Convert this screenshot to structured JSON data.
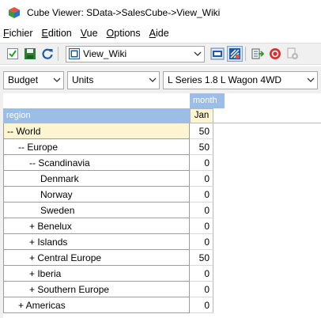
{
  "window": {
    "title": "Cube Viewer: SData->SalesCube->View_Wiki"
  },
  "menu": [
    {
      "label": "Fichier",
      "accel": "F"
    },
    {
      "label": "Edition",
      "accel": "E"
    },
    {
      "label": "Vue",
      "accel": "V"
    },
    {
      "label": "Options",
      "accel": "O"
    },
    {
      "label": "Aide",
      "accel": "A"
    }
  ],
  "toolbar": {
    "view_name": "View_Wiki",
    "icons": [
      "checkbox-icon",
      "save-icon",
      "refresh-icon",
      "view-icon",
      "excel-icon",
      "grid-icon",
      "export-icon",
      "stop-icon",
      "settings-icon"
    ]
  },
  "filters": {
    "version": "Budget",
    "measure": "Units",
    "model": "L Series 1.8 L Wagon 4WD"
  },
  "grid": {
    "column_dimension": "month",
    "row_dimension": "region",
    "columns": [
      "Jan"
    ],
    "rows": [
      {
        "label": "-- World",
        "indent": 0,
        "value": "50"
      },
      {
        "label": "-- Europe",
        "indent": 1,
        "value": "50"
      },
      {
        "label": "-- Scandinavia",
        "indent": 2,
        "value": "0"
      },
      {
        "label": "Denmark",
        "indent": 3,
        "value": "0"
      },
      {
        "label": "Norway",
        "indent": 3,
        "value": "0"
      },
      {
        "label": "Sweden",
        "indent": 3,
        "value": "0"
      },
      {
        "label": "+ Benelux",
        "indent": 2,
        "value": "0"
      },
      {
        "label": "+ Islands",
        "indent": 2,
        "value": "0"
      },
      {
        "label": "+ Central Europe",
        "indent": 2,
        "value": "50"
      },
      {
        "label": "+ Iberia",
        "indent": 2,
        "value": "0"
      },
      {
        "label": "+ Southern Europe",
        "indent": 2,
        "value": "0"
      },
      {
        "label": "+ Americas",
        "indent": 1,
        "value": "0"
      }
    ]
  },
  "colors": {
    "header_blue": "#9bbde6",
    "highlight_yellow": "#fdf5d2"
  }
}
